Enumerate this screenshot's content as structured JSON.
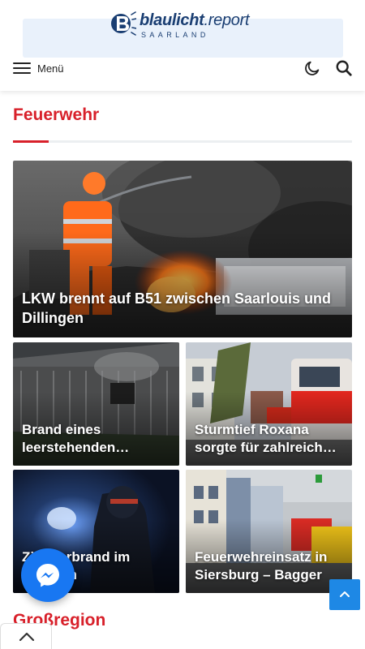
{
  "header": {
    "logo_main": "blaulicht",
    "logo_suffix": ".report",
    "logo_sub": "SAARLAND",
    "menu_label": "Menü",
    "icons": [
      "hamburger-icon",
      "moon-icon",
      "search-icon"
    ]
  },
  "section": {
    "title": "Feuerwehr"
  },
  "articles": [
    {
      "title": "LKW brennt auf B51 zwischen Saarlouis und Dillingen"
    },
    {
      "title": "Brand eines leerstehenden Gebäudes"
    },
    {
      "title": "Sturmtief Roxana sorgte für zahlreiche Einsätze"
    },
    {
      "title": "Zimmerbrand im Zentrum"
    },
    {
      "title": "Feuerwehreinsatz in Siersburg – Bagger"
    }
  ],
  "section2": {
    "title": "Großregion"
  },
  "colors": {
    "accent": "#d8202a",
    "brand": "#1a3e72",
    "messenger": "#1877f2",
    "to_top": "#1e88e5"
  }
}
